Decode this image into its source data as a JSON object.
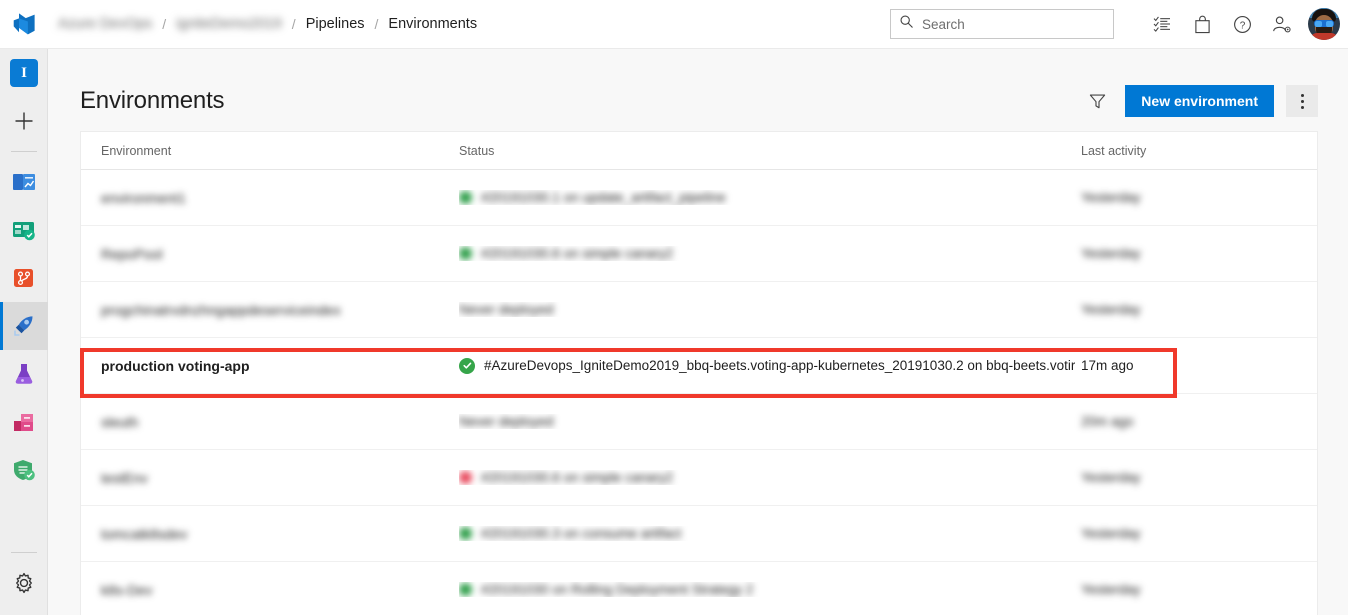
{
  "topbar": {
    "logo_icon": "azure-devops-logo",
    "breadcrumb": [
      {
        "label": "Azure DevOps",
        "blurred": true
      },
      {
        "label": "igniteDemo2019",
        "blurred": true
      },
      {
        "label": "Pipelines",
        "blurred": false
      },
      {
        "label": "Environments",
        "blurred": false
      }
    ],
    "separator": "/",
    "search": {
      "placeholder": "Search",
      "icon": "search-icon"
    },
    "icons": [
      {
        "name": "task-list-icon"
      },
      {
        "name": "marketplace-bag-icon"
      },
      {
        "name": "help-question-icon"
      },
      {
        "name": "user-settings-icon"
      }
    ],
    "avatar_label": "User profile"
  },
  "rail": {
    "project_badge": "I",
    "items": [
      {
        "name": "new-item-plus-icon",
        "label": "New"
      },
      {
        "name": "overview-icon",
        "label": "Overview",
        "selected": false
      },
      {
        "name": "boards-icon",
        "label": "Boards",
        "selected": false
      },
      {
        "name": "repos-icon",
        "label": "Repos",
        "selected": false
      },
      {
        "name": "pipelines-rocket-icon",
        "label": "Pipelines",
        "selected": true
      },
      {
        "name": "test-plans-flask-icon",
        "label": "Test Plans",
        "selected": false
      },
      {
        "name": "artifacts-icon",
        "label": "Artifacts",
        "selected": false
      },
      {
        "name": "security-shield-icon",
        "label": "Security",
        "selected": false
      }
    ],
    "settings": {
      "name": "settings-gear-icon",
      "label": "Project settings"
    }
  },
  "page": {
    "title": "Environments",
    "filter_icon": "filter-funnel-icon",
    "new_button": "New environment",
    "more_button_icon": "more-actions-icon"
  },
  "table": {
    "headers": {
      "environment": "Environment",
      "status": "Status",
      "last_activity": "Last activity"
    },
    "rows": [
      {
        "env": "environment1",
        "env_blurred": true,
        "status_dot": "green",
        "status": "#20191030.1 on update_artifact_pipeline",
        "status_blurred": true,
        "activity": "Yesterday",
        "activity_blurred": true,
        "highlighted": false
      },
      {
        "env": "RepoPool",
        "env_blurred": true,
        "status_dot": "green",
        "status": "#20191030.6 on simple canary2",
        "status_blurred": true,
        "activity": "Yesterday",
        "activity_blurred": true,
        "highlighted": false
      },
      {
        "env": "progchinatrvdnzhngappdeserviceindex",
        "env_blurred": true,
        "status_dot": "none",
        "status": "Never deployed",
        "status_blurred": true,
        "activity": "Yesterday",
        "activity_blurred": true,
        "highlighted": false
      },
      {
        "env": "production voting-app",
        "env_blurred": false,
        "status_dot": "check",
        "status": "#AzureDevops_IgniteDemo2019_bbq-beets.voting-app-kubernetes_20191030.2 on bbq-beets.votir",
        "status_blurred": false,
        "activity": "17m ago",
        "activity_blurred": false,
        "highlighted": true
      },
      {
        "env": "sleuth",
        "env_blurred": true,
        "status_dot": "none",
        "status": "Never deployed",
        "status_blurred": true,
        "activity": "20m ago",
        "activity_blurred": true,
        "highlighted": false
      },
      {
        "env": "testEnv",
        "env_blurred": true,
        "status_dot": "red",
        "status": "#20191030.6 on simple canary2",
        "status_blurred": true,
        "activity": "Yesterday",
        "activity_blurred": true,
        "highlighted": false
      },
      {
        "env": "tomcatk8sdev",
        "env_blurred": true,
        "status_dot": "green",
        "status": "#20191030.3 on consume artifact",
        "status_blurred": true,
        "activity": "Yesterday",
        "activity_blurred": true,
        "highlighted": false
      },
      {
        "env": "k8s-Dev",
        "env_blurred": true,
        "status_dot": "green",
        "status": "#20191030 on Rolling Deployment Strategy 2",
        "status_blurred": true,
        "activity": "Yesterday",
        "activity_blurred": true,
        "highlighted": false
      }
    ]
  },
  "annotation": {
    "highlight_color": "#f0392b",
    "highlighted_row_label": "production voting-app"
  }
}
